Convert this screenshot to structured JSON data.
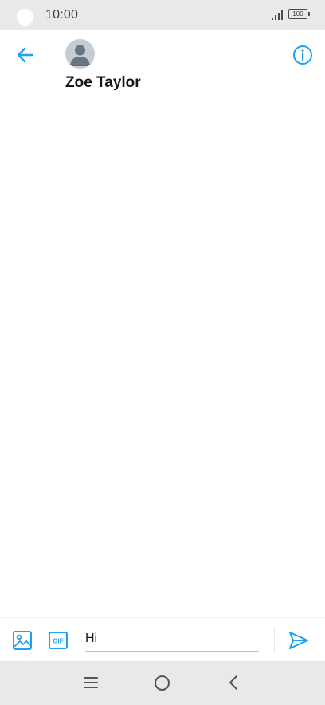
{
  "status_bar": {
    "time": "10:00",
    "battery_level": "100",
    "signal_icon": "signal-bars-icon"
  },
  "header": {
    "back_icon": "arrow-left-icon",
    "avatar_icon": "default-avatar-icon",
    "contact_name": "Zoe Taylor",
    "info_icon": "info-icon"
  },
  "composer": {
    "image_icon": "image-icon",
    "gif_label": "GIF",
    "message_value": "Hi",
    "send_icon": "send-icon"
  },
  "nav_bar": {
    "menu_icon": "recent-apps-icon",
    "home_icon": "home-icon",
    "back_icon": "back-chevron-icon"
  },
  "colors": {
    "accent": "#1da1f2",
    "system_bar": "#e9e9e9",
    "text_primary": "#14171a",
    "avatar_bg": "#c5ccd3",
    "avatar_fg": "#66757f"
  }
}
